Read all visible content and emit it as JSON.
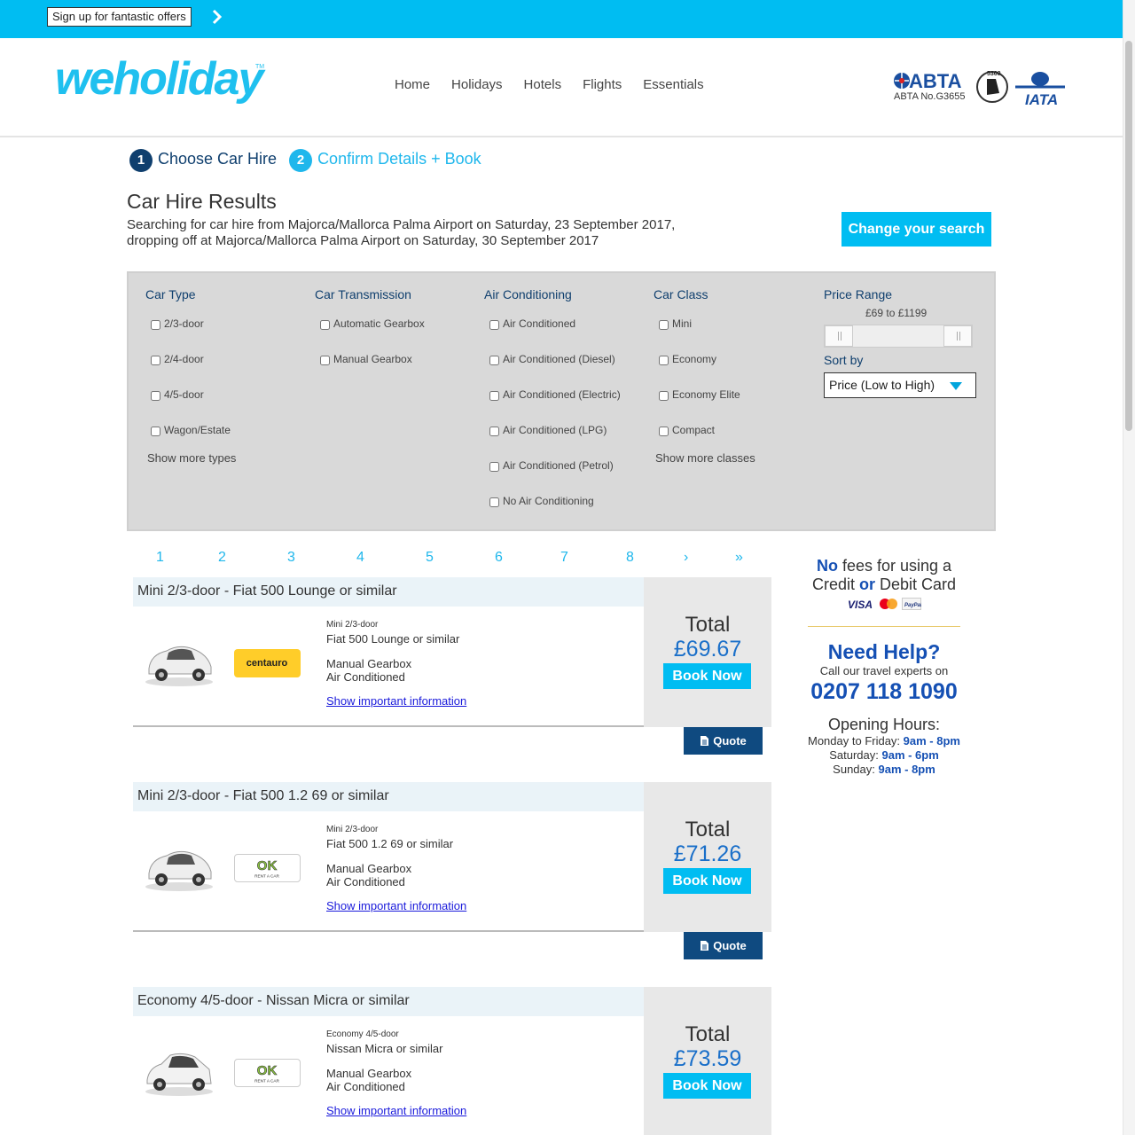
{
  "topbar": {
    "signup_label": "Sign up for fantastic offers"
  },
  "brand": {
    "logo_text": "weholiday",
    "abta_number": "ABTA No.G3655"
  },
  "nav": [
    "Home",
    "Holidays",
    "Hotels",
    "Flights",
    "Essentials"
  ],
  "steps": [
    {
      "num": "1",
      "label": "Choose Car Hire"
    },
    {
      "num": "2",
      "label": "Confirm Details + Book"
    }
  ],
  "page": {
    "title": "Car Hire Results",
    "summary": "Searching for car hire from Majorca/Mallorca Palma Airport on Saturday, 23 September 2017, dropping off at Majorca/Mallorca Palma Airport on Saturday, 30 September 2017",
    "change_search": "Change your search"
  },
  "filters": {
    "car_type": {
      "title": "Car Type",
      "options": [
        "2/3-door",
        "2/4-door",
        "4/5-door",
        "Wagon/Estate"
      ],
      "show_more": "Show more types"
    },
    "transmission": {
      "title": "Car Transmission",
      "options": [
        "Automatic Gearbox",
        "Manual Gearbox"
      ]
    },
    "air": {
      "title": "Air Conditioning",
      "options": [
        "Air Conditioned",
        "Air Conditioned (Diesel)",
        "Air Conditioned (Electric)",
        "Air Conditioned (LPG)",
        "Air Conditioned (Petrol)",
        "No Air Conditioning"
      ]
    },
    "car_class": {
      "title": "Car Class",
      "options": [
        "Mini",
        "Economy",
        "Economy Elite",
        "Compact"
      ],
      "show_more": "Show more classes"
    },
    "price": {
      "title": "Price Range",
      "range_label": "£69 to £1199",
      "min": 69,
      "max": 1199
    },
    "sort": {
      "title": "Sort by",
      "selected": "Price (Low to High)"
    }
  },
  "pager": [
    "1",
    "2",
    "3",
    "4",
    "5",
    "6",
    "7",
    "8",
    "›",
    "»"
  ],
  "results": [
    {
      "title": "Mini 2/3-door - Fiat 500 Lounge or similar",
      "class": "Mini 2/3-door",
      "model": "Fiat 500 Lounge or similar",
      "gearbox": "Manual Gearbox",
      "air": "Air Conditioned",
      "info": "Show important information",
      "total_label": "Total",
      "price": "£69.67",
      "book": "Book Now",
      "quote": "Quote",
      "supplier": "centauro"
    },
    {
      "title": "Mini 2/3-door - Fiat 500 1.2 69 or similar",
      "class": "Mini 2/3-door",
      "model": "Fiat 500 1.2 69 or similar",
      "gearbox": "Manual Gearbox",
      "air": "Air Conditioned",
      "info": "Show important information",
      "total_label": "Total",
      "price": "£71.26",
      "book": "Book Now",
      "quote": "Quote",
      "supplier": "OK"
    },
    {
      "title": "Economy 4/5-door - Nissan Micra or similar",
      "class": "Economy 4/5-door",
      "model": "Nissan Micra or similar",
      "gearbox": "Manual Gearbox",
      "air": "Air Conditioned",
      "info": "Show important information",
      "total_label": "Total",
      "price": "£73.59",
      "book": "Book Now",
      "supplier": "OK"
    }
  ],
  "sidebar": {
    "no": "No",
    "fees_text": "fees for using a",
    "credit": "Credit",
    "or": "or",
    "debit": "Debit Card",
    "help_title": "Need Help?",
    "help_sub": "Call our travel experts on",
    "phone": "0207 118 1090",
    "hours_title": "Opening Hours:",
    "hours": [
      {
        "day": "Monday to Friday:",
        "time": "9am - 8pm"
      },
      {
        "day": "Saturday:",
        "time": "9am - 6pm"
      },
      {
        "day": "Sunday:",
        "time": "9am - 8pm"
      }
    ]
  },
  "colors": {
    "brand_blue": "#00bdf2",
    "navy": "#0f3f6e",
    "link_blue": "#1550b4"
  }
}
